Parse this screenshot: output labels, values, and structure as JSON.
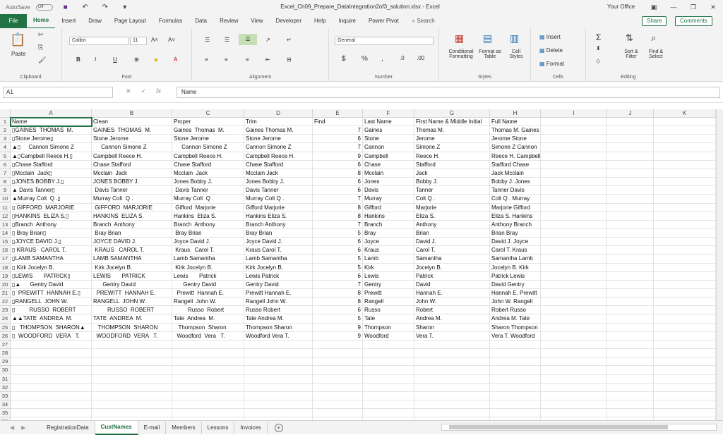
{
  "titlebar": {
    "autosave": "AutoSave",
    "autosave_state": "Off",
    "title": "Excel_Ch09_Prepare_DataIntegration2of3_solution.xlsx  -  Excel",
    "user": "Your Office"
  },
  "tabs": [
    "File",
    "Home",
    "Insert",
    "Draw",
    "Page Layout",
    "Formulas",
    "Data",
    "Review",
    "View",
    "Developer",
    "Help",
    "Inquire",
    "Power Pivot"
  ],
  "active_tab": "Home",
  "search_label": "Search",
  "share_label": "Share",
  "comments_label": "Comments",
  "ribbon": {
    "clipboard": {
      "label": "Clipboard",
      "paste": "Paste"
    },
    "font": {
      "label": "Font",
      "name": "Calibri",
      "size": "11"
    },
    "alignment": {
      "label": "Alignment"
    },
    "number": {
      "label": "Number",
      "format": "General"
    },
    "styles": {
      "label": "Styles",
      "conditional_a": "Conditional",
      "conditional_b": "Formatting",
      "format_table_a": "Format as",
      "format_table_b": "Table",
      "cell_styles_a": "Cell",
      "cell_styles_b": "Styles"
    },
    "cells": {
      "label": "Cells",
      "insert": "Insert",
      "delete": "Delete",
      "format": "Format"
    },
    "editing": {
      "label": "Editing",
      "sort_a": "Sort &",
      "sort_b": "Filter",
      "find_a": "Find &",
      "find_b": "Select"
    }
  },
  "formula_bar": {
    "name_box": "A1",
    "content": "Name"
  },
  "columns": [
    "A",
    "B",
    "C",
    "D",
    "E",
    "F",
    "G",
    "H",
    "I",
    "J",
    "K"
  ],
  "grid": {
    "header": [
      "Name",
      "Clean",
      "Proper",
      "Trim",
      "Find",
      "Last Name",
      "First Name & Middle Initial",
      "Full Name"
    ],
    "rows": [
      [
        "▯GAINES  THOMAS  M.",
        "GAINES  THOMAS  M.",
        "Gaines  Thomas  M.",
        "Gaines Thomas M.",
        "7",
        "Gaines",
        "Thomas M.",
        "Thomas M. Gaines"
      ],
      [
        "▯Stone Jerome▯",
        "Stone Jerome",
        "Stone Jerome",
        "Stone Jerome",
        "6",
        "Stone",
        "Jerome",
        "Jerome Stone"
      ],
      [
        "▲▯     Cannon Simone Z",
        "     Cannon Simone Z",
        "     Cannon Simone Z",
        "Cannon Simone Z",
        "7",
        "Cannon",
        "Simone Z",
        "Simone Z Cannon"
      ],
      [
        "▲▯Campbell Reece H.▯",
        "Campbell Reece H.",
        "Campbell Reece H.",
        "Campbell Reece H.",
        "9",
        "Campbell",
        "Reece H.",
        "Reece H. Campbell"
      ],
      [
        "▯Chase Stafford",
        "Chase Stafford",
        "Chase Stafford",
        "Chase Stafford",
        "6",
        "Chase",
        "Stafford",
        "Stafford Chase"
      ],
      [
        "▯Mcclain  Jack▯",
        "Mcclain  Jack",
        "Mcclain  Jack",
        "Mcclain Jack",
        "8",
        "Mcclain",
        "Jack",
        "Jack Mcclain"
      ],
      [
        "▯JONES BOBBY J.▯",
        "JONES BOBBY J.",
        "Jones Bobby J.",
        "Jones Bobby J.",
        "6",
        "Jones",
        "Bobby J.",
        "Bobby J. Jones"
      ],
      [
        "▲ Davis Tanner▯",
        " Davis Tanner",
        " Davis Tanner",
        "Davis Tanner",
        "6",
        "Davis",
        "Tanner",
        "Tanner Davis"
      ],
      [
        "▲Murray Colt  Q .▯",
        "Murray Colt  Q .",
        "Murray Colt  Q .",
        "Murray Colt Q .",
        "7",
        "Murray",
        "Colt Q .",
        "Colt Q . Murray"
      ],
      [
        "▯ GIFFORD  MARJORIE",
        " GIFFORD  MARJORIE",
        " Gifford  Marjorie",
        "Gifford Marjorie",
        "8",
        "Gifford",
        "Marjorie",
        "Marjorie Gifford"
      ],
      [
        "▯HANKINS  ELIZA S.▯",
        "HANKINS  ELIZA S.",
        "Hankins  Eliza S.",
        "Hankins Eliza S.",
        "8",
        "Hankins",
        "Eliza S.",
        "Eliza S. Hankins"
      ],
      [
        "▯Branch  Anthony",
        "Branch  Anthony",
        "Branch  Anthony",
        "Branch Anthony",
        "7",
        "Branch",
        "Anthony",
        "Anthony Branch"
      ],
      [
        "▯ Bray Brian▯",
        " Bray Brian",
        " Bray Brian",
        "Bray Brian",
        "5",
        "Bray",
        "Brian",
        "Brian Bray"
      ],
      [
        "▯JOYCE DAVID J.▯",
        "JOYCE DAVID J.",
        "Joyce David J.",
        "Joyce David J.",
        "6",
        "Joyce",
        "David J.",
        "David J. Joyce"
      ],
      [
        "▯ KRAUS   CAROL T.",
        " KRAUS   CAROL T.",
        " Kraus   Carol T.",
        "Kraus Carol T.",
        "6",
        "Kraus",
        "Carol T.",
        "Carol T. Kraus"
      ],
      [
        "▯LAMB SAMANTHA",
        "LAMB SAMANTHA",
        "Lamb Samantha",
        "Lamb Samantha",
        "5",
        "Lamb",
        "Samantha",
        "Samantha Lamb"
      ],
      [
        "▯ Kirk Jocelyn B.",
        " Kirk Jocelyn B.",
        " Kirk Jocelyn B.",
        "Kirk Jocelyn B.",
        "5",
        "Kirk",
        "Jocelyn B.",
        "Jocelyn B. Kirk"
      ],
      [
        "▯LEWIS       PATRICK▯",
        "LEWIS       PATRICK",
        "Lewis       Patrick",
        "Lewis Patrick",
        "6",
        "Lewis",
        "Patrick",
        "Patrick Lewis"
      ],
      [
        "▯▲      Gentry David",
        "      Gentry David",
        "      Gentry David",
        "Gentry David",
        "7",
        "Gentry",
        "David",
        "David Gentry"
      ],
      [
        "▯  PREWITT  HANNAH E.▯",
        "  PREWITT  HANNAH E.",
        "  Prewitt  Hannah E.",
        "Prewitt Hannah E.",
        "8",
        "Prewitt",
        "Hannah E.",
        "Hannah E. Prewitt"
      ],
      [
        "▯RANGELL  JOHN W.",
        "RANGELL  JOHN W.",
        "Rangell  John W.",
        "Rangell John W.",
        "8",
        "Rangell",
        "John W.",
        "John W. Rangell"
      ],
      [
        "▯         RUSSO  ROBERT",
        "         RUSSO  ROBERT",
        "         Russo  Robert",
        "Russo Robert",
        "6",
        "Russo",
        "Robert",
        "Robert Russo"
      ],
      [
        "▲▲TATE  ANDREA  M.",
        "TATE  ANDREA  M.",
        "Tate  Andrea  M.",
        "Tate Andrea M.",
        "5",
        "Tate",
        "Andrea M.",
        "Andrea M. Tate"
      ],
      [
        "▯   THOMPSON  SHARON▲",
        "   THOMPSON  SHARON",
        "   Thompson  Sharon",
        "Thompson Sharon",
        "9",
        "Thompson",
        "Sharon",
        "Sharon Thompson"
      ],
      [
        "▯  WOODFORD  VERA   T.",
        "  WOODFORD  VERA   T.",
        "  Woodford  Vera   T.",
        "Woodford Vera T.",
        "9",
        "Woodford",
        "Vera T.",
        "Vera T. Woodford"
      ]
    ],
    "row_count": 36
  },
  "sheet_tabs": [
    "RegistrationData",
    "CustNames",
    "E-mail",
    "Members",
    "Lessons",
    "Invoices"
  ],
  "active_sheet": "CustNames"
}
